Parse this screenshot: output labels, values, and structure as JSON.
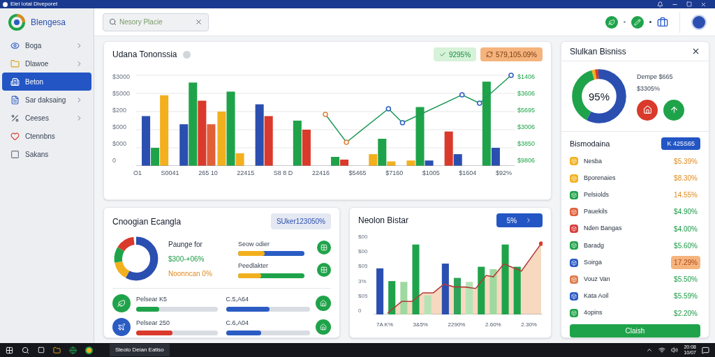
{
  "window": {
    "title": "Elel Iotal Diveporet"
  },
  "app": {
    "name": "Blengesa"
  },
  "search": {
    "placeholder": "Nesory Placie"
  },
  "sidebar": {
    "items": [
      {
        "label": "Boga",
        "kind": "eye",
        "selected": false,
        "chevron": true
      },
      {
        "label": "Dlawoe",
        "kind": "folder",
        "selected": false,
        "chevron": true
      },
      {
        "label": "Beton",
        "kind": "building",
        "selected": true,
        "chevron": false
      },
      {
        "label": "Sar daksaing",
        "kind": "document",
        "selected": false,
        "chevron": true
      },
      {
        "label": "Ceeses",
        "kind": "percent",
        "selected": false,
        "chevron": true
      },
      {
        "label": "Ctennbns",
        "kind": "heart",
        "selected": false,
        "chevron": false
      },
      {
        "label": "Sakans",
        "kind": "square",
        "selected": false,
        "chevron": false
      }
    ]
  },
  "main_chart": {
    "title": "Udana Tononssia",
    "badges": [
      {
        "text": "9295%",
        "kind": "positive"
      },
      {
        "text": "579,105.09%",
        "kind": "warning"
      }
    ],
    "y_labels": [
      "$3000",
      "$5000",
      "$200",
      "$000",
      "$000",
      "0"
    ],
    "right_labels": [
      "$1406",
      "$3606",
      "$5695",
      "$3006",
      "$3850",
      "$9806"
    ],
    "x_labels": [
      "O1",
      "S0041",
      "265 10",
      "22415",
      "S8 8 D",
      "22416",
      "$5465",
      "$7160",
      "$1005",
      "$1604",
      "$92%"
    ]
  },
  "overview": {
    "title": "Cnoogian Ecangla",
    "badge": "SUker123050%",
    "legend": [
      {
        "text": "Paunge for",
        "kind": "label"
      },
      {
        "text": "$300-+06%",
        "kind": "positive"
      },
      {
        "text": "Noonncan 0%",
        "kind": "warning"
      }
    ],
    "top_metrics": [
      {
        "label": "Seow odier",
        "level": 0.4,
        "color": "#f2b01e"
      },
      {
        "label": "Peedlakter",
        "level": 0.35,
        "color": "#f2b01e"
      }
    ],
    "bottom_metrics": [
      {
        "label": "Pelsear K5",
        "level": 0.28,
        "color": "#1fa34a"
      },
      {
        "label": "C.5,A64",
        "level": 0.52,
        "color": "#2b5cc4"
      },
      {
        "label": "Pelsear 250",
        "level": 0.45,
        "color": "#d93a2b"
      },
      {
        "label": "C.6,A04",
        "level": 0.42,
        "color": "#2b5cc4"
      }
    ]
  },
  "trend": {
    "title": "Neolon Bistar",
    "button": "5%",
    "y_labels": [
      "$00",
      "$00",
      "$05",
      "3%",
      "$05",
      "0"
    ],
    "x_labels": [
      "7A K%",
      "3&5%",
      "2290%",
      "2.60%",
      "2.30%"
    ]
  },
  "business": {
    "title": "Slulkan Bisniss",
    "donut_label": "95%",
    "caption": "Dempe $665",
    "amount": "$3305%",
    "list_title": "Bismodaina",
    "list_button": "K 425S65",
    "rows": [
      {
        "name": "Nesba",
        "value": "$5.39%",
        "color": "#f2b01e",
        "highlight": false,
        "kind": "warning"
      },
      {
        "name": "Bporenaies",
        "value": "$8.30%",
        "color": "#f2b01e",
        "highlight": false,
        "kind": "warning"
      },
      {
        "name": "Pelsiolds",
        "value": "14.55%",
        "color": "#1fa34a",
        "highlight": false,
        "kind": "warning"
      },
      {
        "name": "Pauekils",
        "value": "$4.90%",
        "color": "#e0603a",
        "highlight": false,
        "kind": "positive"
      },
      {
        "name": "Nden Bangas",
        "value": "$4.00%",
        "color": "#d93a3a",
        "highlight": false,
        "kind": "positive"
      },
      {
        "name": "Baradg",
        "value": "$5.60%",
        "color": "#1fa34a",
        "highlight": false,
        "kind": "positive"
      },
      {
        "name": "Soirga",
        "value": "17.29%",
        "color": "#2b5cc4",
        "highlight": true,
        "kind": "warning"
      },
      {
        "name": "Vouz Van",
        "value": "$5.50%",
        "color": "#e07a4a",
        "highlight": false,
        "kind": "positive"
      },
      {
        "name": "Kata Aoil",
        "value": "$5.59%",
        "color": "#2b5cc4",
        "highlight": false,
        "kind": "positive"
      },
      {
        "name": "4opins",
        "value": "$2.20%",
        "color": "#1fa34a",
        "highlight": false,
        "kind": "positive"
      }
    ],
    "action": "Claish"
  },
  "taskbar": {
    "app": "Sleolo Deian Eatiso",
    "time": "20:08",
    "date": "10/07"
  }
}
